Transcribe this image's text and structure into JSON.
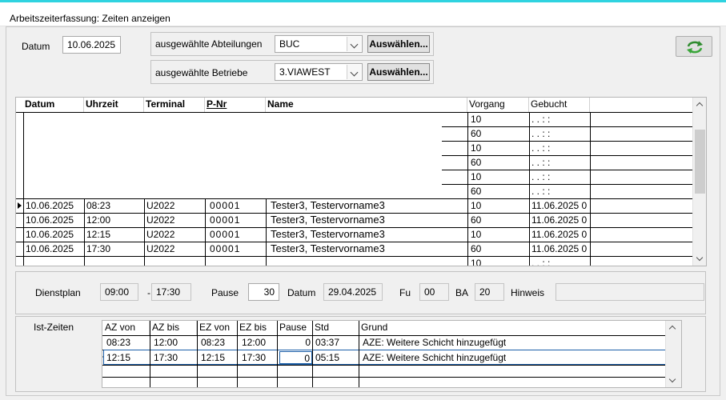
{
  "window": {
    "title": "Arbeitszeiterfassung: Zeiten anzeigen"
  },
  "filter": {
    "datum_label": "Datum",
    "datum_value": "10.06.2025",
    "abteilungen_label": "ausgewählte Abteilungen",
    "abteilungen_value": "BUC",
    "betriebe_label": "ausgewählte Betriebe",
    "betriebe_value": "3.VIAWEST",
    "select_button_1": "Auswählen...",
    "select_button_2": "Auswählen..."
  },
  "refresh_icon": "refresh-icon",
  "times_grid": {
    "columns": [
      "Datum",
      "Uhrzeit",
      "Terminal",
      "P-Nr",
      "Name",
      "Vorgang",
      "Gebucht"
    ],
    "partial_rows": [
      {
        "vorgang": "10",
        "gebucht": ". .     : :"
      },
      {
        "vorgang": "60",
        "gebucht": ". .     : :"
      },
      {
        "vorgang": "10",
        "gebucht": ". .     : :"
      },
      {
        "vorgang": "60",
        "gebucht": ". .     : :"
      },
      {
        "vorgang": "10",
        "gebucht": ". .     : :"
      },
      {
        "vorgang": "60",
        "gebucht": ". .     : :"
      }
    ],
    "rows": [
      {
        "datum": "10.06.2025",
        "uhrzeit": "08:23",
        "terminal": "U2022",
        "pnr": "00001",
        "name": "Tester3, Testervorname3",
        "vorgang": "10",
        "gebucht": "11.06.2025 0"
      },
      {
        "datum": "10.06.2025",
        "uhrzeit": "12:00",
        "terminal": "U2022",
        "pnr": "00001",
        "name": "Tester3, Testervorname3",
        "vorgang": "60",
        "gebucht": "11.06.2025 0"
      },
      {
        "datum": "10.06.2025",
        "uhrzeit": "12:15",
        "terminal": "U2022",
        "pnr": "00001",
        "name": "Tester3, Testervorname3",
        "vorgang": "10",
        "gebucht": "11.06.2025 0"
      },
      {
        "datum": "10.06.2025",
        "uhrzeit": "17:30",
        "terminal": "U2022",
        "pnr": "00001",
        "name": "Tester3, Testervorname3",
        "vorgang": "60",
        "gebucht": "11.06.2025 0"
      }
    ],
    "last_row": {
      "vorgang": "10",
      "gebucht": ". .     : :"
    }
  },
  "dienstplan": {
    "label": "Dienstplan",
    "from": "09:00",
    "dash": "-",
    "to": "17:30",
    "pause_label": "Pause",
    "pause_value": "30",
    "datum_label": "Datum",
    "datum_value": "29.04.2025",
    "fu_label": "Fu",
    "fu_value": "00",
    "ba_label": "BA",
    "ba_value": "20",
    "hinweis_label": "Hinweis",
    "hinweis_value": ""
  },
  "ist_zeiten": {
    "label": "Ist-Zeiten",
    "columns": [
      "AZ von",
      "AZ bis",
      "EZ von",
      "EZ bis",
      "Pause",
      "Std",
      "Grund"
    ],
    "rows": [
      {
        "az_von": "08:23",
        "az_bis": "12:00",
        "ez_von": "08:23",
        "ez_bis": "12:00",
        "pause": "0",
        "std": "03:37",
        "grund": "AZE: Weitere Schicht hinzugefügt"
      },
      {
        "az_von": "12:15",
        "az_bis": "17:30",
        "ez_von": "12:15",
        "ez_bis": "17:30",
        "pause": "0",
        "std": "05:15",
        "grund": "AZE: Weitere Schicht hinzugefügt"
      }
    ]
  }
}
